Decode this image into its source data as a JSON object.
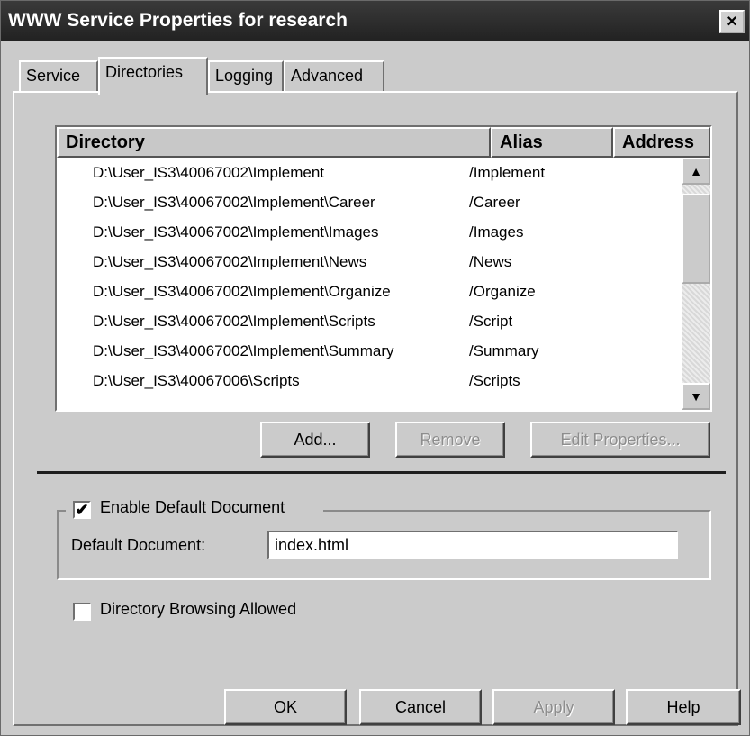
{
  "window": {
    "title": "WWW Service Properties for research",
    "close_glyph": "×"
  },
  "tabs": [
    {
      "label": "Service",
      "active": false
    },
    {
      "label": "Directories",
      "active": true
    },
    {
      "label": "Logging",
      "active": false
    },
    {
      "label": "Advanced",
      "active": false
    }
  ],
  "directories": {
    "columns": {
      "directory": "Directory",
      "alias": "Alias",
      "address": "Address"
    },
    "rows": [
      {
        "directory": "D:\\User_IS3\\40067002\\Implement",
        "alias": "/Implement"
      },
      {
        "directory": "D:\\User_IS3\\40067002\\Implement\\Career",
        "alias": "/Career"
      },
      {
        "directory": "D:\\User_IS3\\40067002\\Implement\\Images",
        "alias": "/Images"
      },
      {
        "directory": "D:\\User_IS3\\40067002\\Implement\\News",
        "alias": "/News"
      },
      {
        "directory": "D:\\User_IS3\\40067002\\Implement\\Organize",
        "alias": "/Organize"
      },
      {
        "directory": "D:\\User_IS3\\40067002\\Implement\\Scripts",
        "alias": "/Script"
      },
      {
        "directory": "D:\\User_IS3\\40067002\\Implement\\Summary",
        "alias": "/Summary"
      },
      {
        "directory": "D:\\User_IS3\\40067006\\Scripts",
        "alias": "/Scripts"
      }
    ],
    "scroll_up_glyph": "▲",
    "scroll_down_glyph": "▼"
  },
  "buttons": {
    "add": "Add...",
    "remove": "Remove",
    "edit_properties": "Edit Properties...",
    "ok": "OK",
    "cancel": "Cancel",
    "apply": "Apply",
    "help": "Help"
  },
  "default_document": {
    "enable_label": "Enable Default Document",
    "enabled": true,
    "check_glyph": "✔",
    "field_label": "Default Document:",
    "value": "index.html"
  },
  "directory_browsing": {
    "label": "Directory Browsing Allowed",
    "checked": false
  }
}
